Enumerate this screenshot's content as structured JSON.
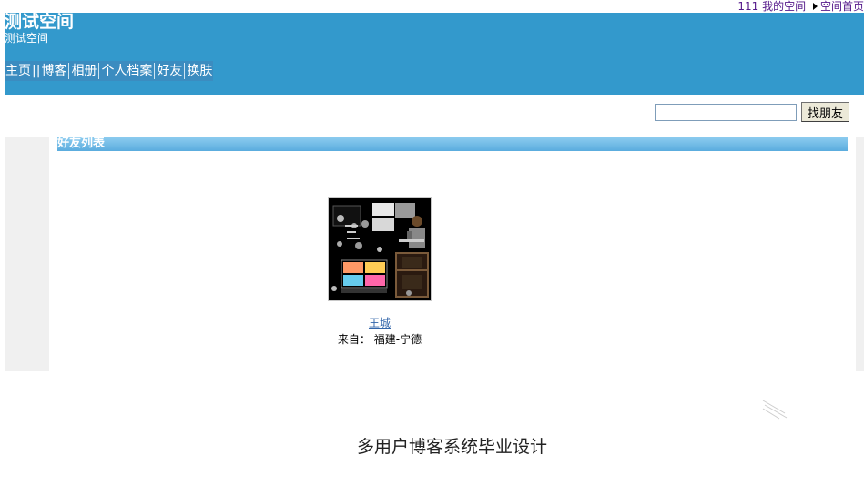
{
  "top_bar": {
    "username": "111",
    "my_space_link": "我的空间",
    "space_home_link": "空间首页"
  },
  "header": {
    "title": "测试空间",
    "subtitle": "测试空间"
  },
  "nav": {
    "home": "主页",
    "sep_text": "||",
    "blog": "博客",
    "album": "相册",
    "profile": "个人档案",
    "friends": "好友",
    "skin": "换肤"
  },
  "search": {
    "value": "",
    "button_label": "找朋友"
  },
  "section": {
    "title": "好友列表"
  },
  "friend": {
    "name": "王城",
    "from_label": "来自：",
    "location": "福建-宁德"
  },
  "footer": {
    "text": "多用户博客系统毕业设计"
  },
  "colors": {
    "banner": "#3399cc",
    "nav": "#3b8cc0",
    "section_header": "#5aacde",
    "link": "#3366aa"
  },
  "icons": {
    "arrow": "right-triangle-icon",
    "watermark": "diagonal-lines-icon"
  }
}
